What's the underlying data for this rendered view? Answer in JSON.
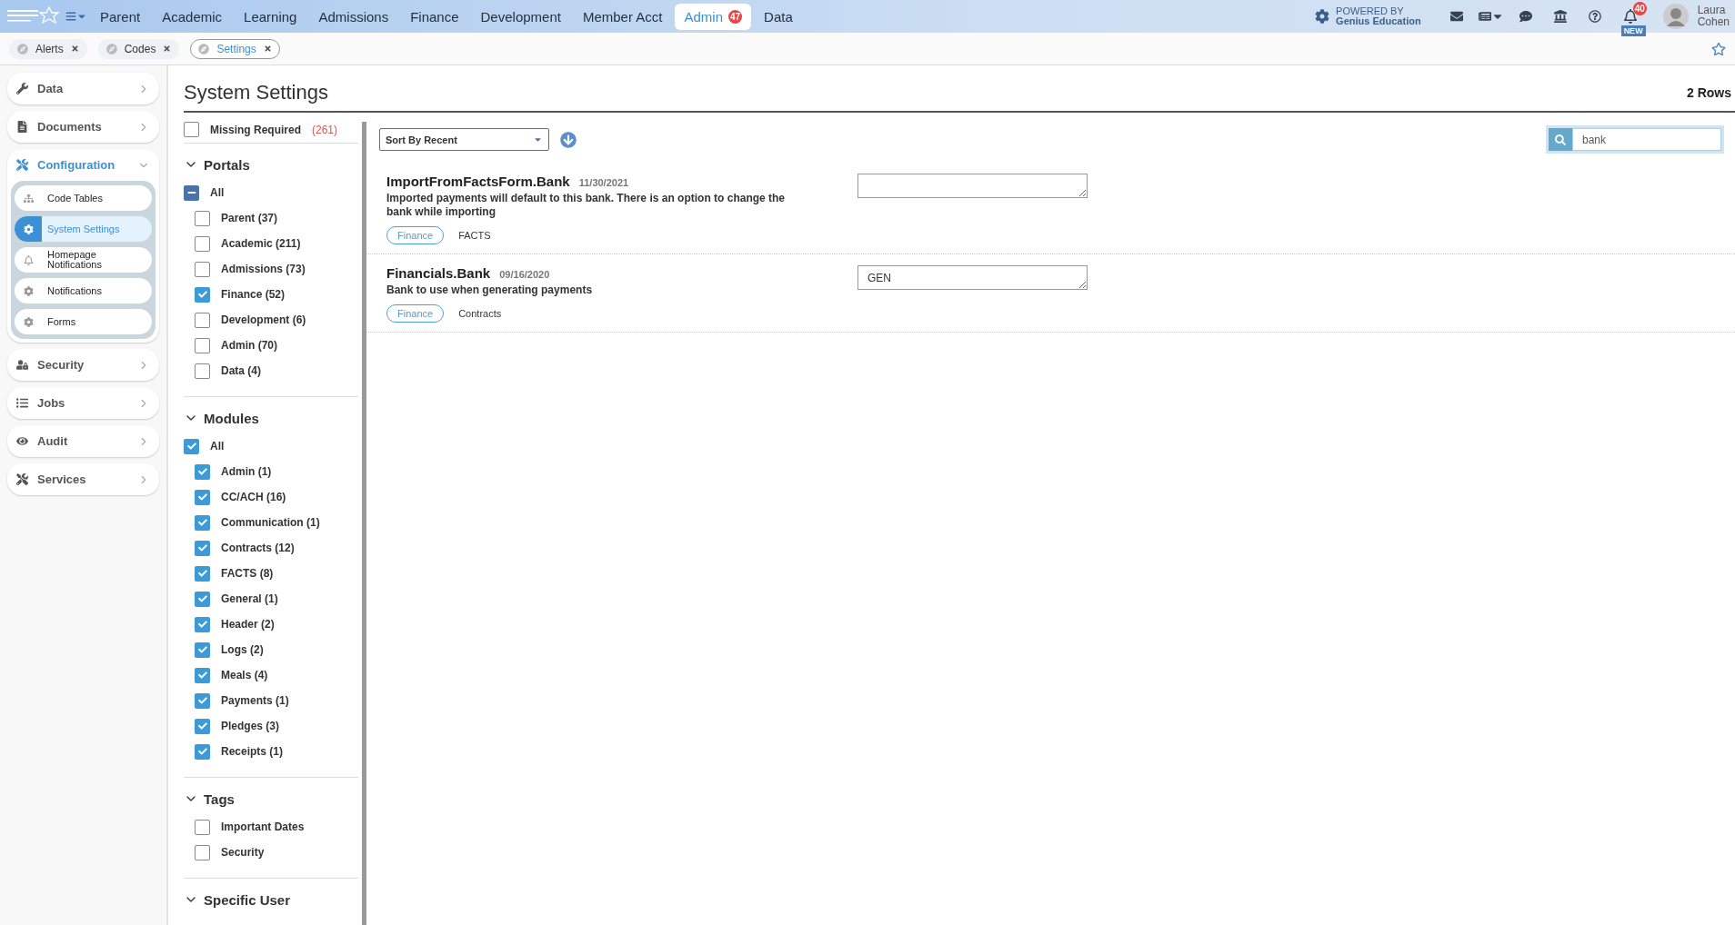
{
  "top_nav": {
    "items": [
      {
        "label": "Parent",
        "selected": false
      },
      {
        "label": "Academic",
        "selected": false
      },
      {
        "label": "Learning",
        "selected": false
      },
      {
        "label": "Admissions",
        "selected": false
      },
      {
        "label": "Finance",
        "selected": false
      },
      {
        "label": "Development",
        "selected": false
      },
      {
        "label": "Member Acct",
        "selected": false
      },
      {
        "label": "Admin",
        "selected": true,
        "badge": "47"
      },
      {
        "label": "Data",
        "selected": false
      }
    ],
    "powered_by": [
      "POWERED BY",
      "Genius Education"
    ],
    "notification_badge": "40",
    "new_label": "NEW",
    "user": [
      "Laura",
      "Cohen"
    ]
  },
  "open_tabs": [
    {
      "label": "Alerts",
      "selected": false
    },
    {
      "label": "Codes",
      "selected": false
    },
    {
      "label": "Settings",
      "selected": true
    }
  ],
  "sidebar": {
    "items": [
      {
        "label": "Data",
        "expanded": false
      },
      {
        "label": "Documents",
        "expanded": false
      },
      {
        "label": "Configuration",
        "expanded": true,
        "children": [
          {
            "label": "Code Tables",
            "selected": false
          },
          {
            "label": "System Settings",
            "selected": true
          },
          {
            "label": "Homepage Notifications",
            "selected": false
          },
          {
            "label": "Notifications",
            "selected": false
          },
          {
            "label": "Forms",
            "selected": false
          }
        ]
      },
      {
        "label": "Security",
        "expanded": false
      },
      {
        "label": "Jobs",
        "expanded": false
      },
      {
        "label": "Audit",
        "expanded": false
      },
      {
        "label": "Services",
        "expanded": false
      }
    ]
  },
  "page": {
    "title": "System Settings",
    "row_count": "2 Rows"
  },
  "filters": {
    "missing_required": {
      "label": "Missing Required",
      "count": "(261)",
      "checked": false
    },
    "groups": [
      {
        "title": "Portals",
        "expanded": true,
        "all": {
          "label": "All",
          "partial": true
        },
        "options": [
          {
            "label": "Parent (37)",
            "checked": false
          },
          {
            "label": "Academic (211)",
            "checked": false
          },
          {
            "label": "Admissions (73)",
            "checked": false
          },
          {
            "label": "Finance (52)",
            "checked": true
          },
          {
            "label": "Development (6)",
            "checked": false
          },
          {
            "label": "Admin (70)",
            "checked": false
          },
          {
            "label": "Data (4)",
            "checked": false
          }
        ]
      },
      {
        "title": "Modules",
        "expanded": true,
        "all": {
          "label": "All",
          "checked": true
        },
        "options": [
          {
            "label": "Admin (1)",
            "checked": true
          },
          {
            "label": "CC/ACH (16)",
            "checked": true
          },
          {
            "label": "Communication (1)",
            "checked": true
          },
          {
            "label": "Contracts (12)",
            "checked": true
          },
          {
            "label": "FACTS (8)",
            "checked": true
          },
          {
            "label": "General (1)",
            "checked": true
          },
          {
            "label": "Header (2)",
            "checked": true
          },
          {
            "label": "Logs (2)",
            "checked": true
          },
          {
            "label": "Meals (4)",
            "checked": true
          },
          {
            "label": "Payments (1)",
            "checked": true
          },
          {
            "label": "Pledges (3)",
            "checked": true
          },
          {
            "label": "Receipts (1)",
            "checked": true
          }
        ]
      },
      {
        "title": "Tags",
        "expanded": true,
        "options": [
          {
            "label": "Important Dates",
            "checked": false
          },
          {
            "label": "Security",
            "checked": false
          }
        ]
      },
      {
        "title": "Specific User",
        "expanded": true
      }
    ]
  },
  "toolbar": {
    "sort": "Sort By Recent",
    "search": "bank"
  },
  "settings": [
    {
      "name": "ImportFromFactsForm.Bank",
      "date": "11/30/2021",
      "description": "Imported payments will default to this bank. There is an option to change the bank while importing",
      "portal": "Finance",
      "module": "FACTS"
    },
    {
      "name": "Financials.Bank",
      "date": "09/16/2020",
      "description": "Bank to use when generating payments",
      "portal": "Finance",
      "module": "Contracts",
      "value": "GEN"
    }
  ]
}
